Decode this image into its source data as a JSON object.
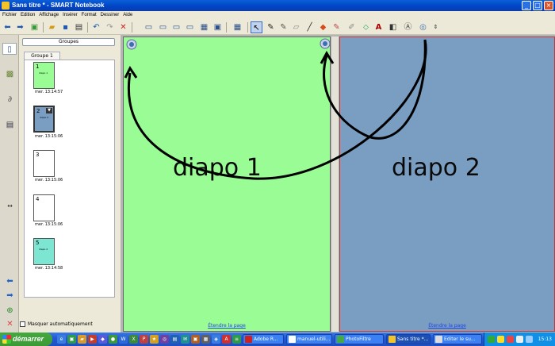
{
  "window": {
    "title": "Sans titre * - SMART Notebook"
  },
  "menu": [
    "Fichier",
    "Edition",
    "Affichage",
    "Insérer",
    "Format",
    "Dessiner",
    "Aide"
  ],
  "sorter": {
    "groups_button": "Groupes",
    "group_label": "Groupe 1",
    "pages": [
      {
        "number": "1",
        "mini_text": "diapo 1",
        "date": "mer. 13:14:57",
        "color": "#9afc94"
      },
      {
        "number": "2",
        "mini_text": "diapo 2",
        "date": "mer. 13:15:06",
        "color": "#7a9ec2"
      },
      {
        "number": "3",
        "mini_text": "",
        "date": "mer. 13:15:06",
        "color": "#ffffff"
      },
      {
        "number": "4",
        "mini_text": "",
        "date": "mer. 13:15:06",
        "color": "#ffffff"
      },
      {
        "number": "5",
        "mini_text": "diapo 2",
        "date": "mer. 13:14:58",
        "color": "#7de6d3"
      }
    ],
    "auto_hide_label": "Masquer automatiquement"
  },
  "canvas": {
    "page1": {
      "label": "diapo 1",
      "link": "Étendre la page",
      "color": "#9afc94"
    },
    "page2": {
      "label": "diapo 2",
      "link": "Étendre la page",
      "color": "#7a9ec2"
    }
  },
  "taskbar": {
    "start_label": "démarrer",
    "tasks": [
      "Adobe R...",
      "manuel-utili...",
      "PhotoFiltre",
      "Sans titre *...",
      "Editer le su..."
    ],
    "active_task": "Sans titre *...",
    "clock": "15:13"
  }
}
